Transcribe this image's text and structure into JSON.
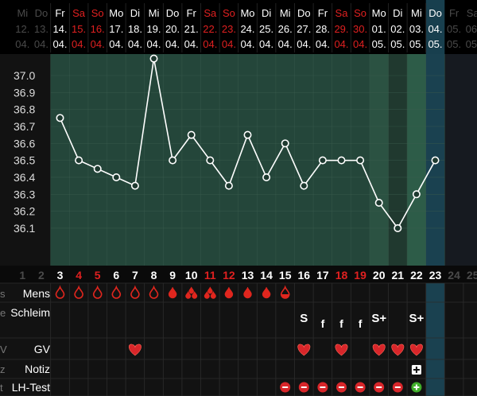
{
  "colors": {
    "background": "#121212",
    "header_bg": "#000000",
    "chart_green": "#24463a",
    "chart_green_bright": "#2d5c48",
    "today_blue": "#1c4a5c",
    "text_white": "#ffffff",
    "text_red": "#e02020",
    "grid": "#2c2c2c",
    "blood_red": "#e0261e",
    "heart_red": "#d8262a"
  },
  "header": {
    "weekdays": [
      "Mi",
      "Do",
      "Fr",
      "Sa",
      "So",
      "Mo",
      "Di",
      "Mi",
      "Do",
      "Fr",
      "Sa",
      "So",
      "Mo",
      "Di",
      "Mi",
      "Do",
      "Fr",
      "Sa",
      "So",
      "Mo",
      "Di",
      "Mi",
      "Do",
      "Fr",
      "Sa"
    ],
    "daynums": [
      "12.",
      "13.",
      "14.",
      "15.",
      "16.",
      "17.",
      "18.",
      "19.",
      "20.",
      "21.",
      "22.",
      "23.",
      "24.",
      "25.",
      "26.",
      "27.",
      "28.",
      "29.",
      "30.",
      "01.",
      "02.",
      "03.",
      "04.",
      "05.",
      "06."
    ],
    "months": [
      "04.",
      "04.",
      "04.",
      "04.",
      "04.",
      "04.",
      "04.",
      "04.",
      "04.",
      "04.",
      "04.",
      "04.",
      "04.",
      "04.",
      "04.",
      "04.",
      "04.",
      "04.",
      "04.",
      "05.",
      "05.",
      "05.",
      "05.",
      "05.",
      "05."
    ],
    "weekend_flags": [
      false,
      false,
      false,
      true,
      true,
      false,
      false,
      false,
      false,
      false,
      true,
      true,
      false,
      false,
      false,
      false,
      false,
      true,
      true,
      false,
      false,
      false,
      false,
      false,
      true
    ]
  },
  "cycle_days": [
    "1",
    "2",
    "3",
    "4",
    "5",
    "6",
    "7",
    "8",
    "9",
    "10",
    "11",
    "12",
    "13",
    "14",
    "15",
    "16",
    "17",
    "18",
    "19",
    "20",
    "21",
    "22",
    "23",
    "24",
    "25"
  ],
  "row_labels": {
    "mens": "Mens",
    "schleim": "Schleim",
    "gv": "GV",
    "notiz": "Notiz",
    "lh_test": "LH-Test"
  },
  "edge_labels": [
    "s",
    "e",
    "V",
    "z",
    "t"
  ],
  "chart_data": {
    "type": "line",
    "title": "",
    "xlabel": "",
    "ylabel": "",
    "ylim": [
      36.0,
      37.1
    ],
    "yticks": [
      "37.0",
      "36.9",
      "36.8",
      "36.7",
      "36.6",
      "36.5",
      "36.4",
      "36.3",
      "36.2",
      "36.1"
    ],
    "ytick_values": [
      37.0,
      36.9,
      36.8,
      36.7,
      36.6,
      36.5,
      36.4,
      36.3,
      36.2,
      36.1
    ],
    "x": [
      3,
      4,
      5,
      6,
      7,
      8,
      9,
      10,
      11,
      12,
      13,
      14,
      15,
      16,
      17,
      18,
      19,
      20,
      21,
      22,
      23
    ],
    "series": [
      {
        "values": [
          36.75,
          36.5,
          36.45,
          36.4,
          36.35,
          37.1,
          36.5,
          36.65,
          36.5,
          36.35,
          36.65,
          36.4,
          36.6,
          36.35,
          36.5,
          36.5,
          36.5,
          36.25,
          36.1,
          36.3,
          36.5
        ]
      }
    ],
    "grid": true
  },
  "mens_icons": [
    {
      "day": 3,
      "icon": "drop-outline"
    },
    {
      "day": 4,
      "icon": "drop-outline"
    },
    {
      "day": 5,
      "icon": "drop-outline"
    },
    {
      "day": 6,
      "icon": "drop-outline"
    },
    {
      "day": 7,
      "icon": "drop-outline"
    },
    {
      "day": 8,
      "icon": "drop-outline"
    },
    {
      "day": 9,
      "icon": "drop-filled"
    },
    {
      "day": 10,
      "icon": "drops-triple"
    },
    {
      "day": 11,
      "icon": "drops-triple"
    },
    {
      "day": 12,
      "icon": "drop-filled"
    },
    {
      "day": 13,
      "icon": "drop-filled"
    },
    {
      "day": 14,
      "icon": "drop-filled"
    },
    {
      "day": 15,
      "icon": "drop-half"
    }
  ],
  "schleim_marks": [
    {
      "day": 16,
      "text": "S"
    },
    {
      "day": 17,
      "text": "f"
    },
    {
      "day": 18,
      "text": "f"
    },
    {
      "day": 19,
      "text": "f"
    },
    {
      "day": 20,
      "text": "S+"
    },
    {
      "day": 22,
      "text": "S+"
    }
  ],
  "gv_days": [
    7,
    16,
    18,
    20,
    21,
    22
  ],
  "notiz_days": [
    22
  ],
  "lh_tests": [
    {
      "day": 15,
      "result": "negative"
    },
    {
      "day": 16,
      "result": "negative"
    },
    {
      "day": 17,
      "result": "negative"
    },
    {
      "day": 18,
      "result": "negative"
    },
    {
      "day": 19,
      "result": "negative"
    },
    {
      "day": 20,
      "result": "negative"
    },
    {
      "day": 21,
      "result": "negative"
    },
    {
      "day": 22,
      "result": "positive"
    }
  ],
  "ranges": {
    "chart_first_day": 3,
    "chart_last_day": 23,
    "fertile_start_day": 20,
    "fertile_end_day": 22,
    "fertile_bright_day": 22,
    "today_day": 23
  }
}
